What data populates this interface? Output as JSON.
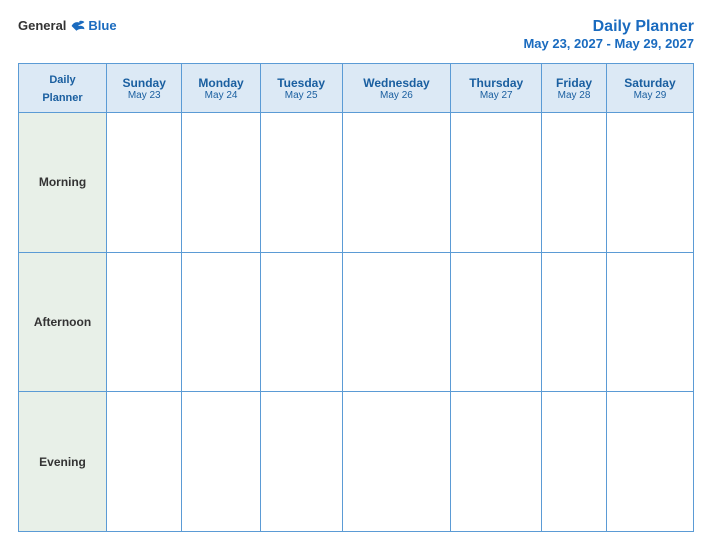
{
  "header": {
    "logo": {
      "general": "General",
      "blue": "Blue",
      "bird_symbol": "▶"
    },
    "title": "Daily Planner",
    "date_range": "May 23, 2027 - May 29, 2027"
  },
  "table": {
    "label_header": "Daily\nPlanner",
    "columns": [
      {
        "day": "Sunday",
        "date": "May 23"
      },
      {
        "day": "Monday",
        "date": "May 24"
      },
      {
        "day": "Tuesday",
        "date": "May 25"
      },
      {
        "day": "Wednesday",
        "date": "May 26"
      },
      {
        "day": "Thursday",
        "date": "May 27"
      },
      {
        "day": "Friday",
        "date": "May 28"
      },
      {
        "day": "Saturday",
        "date": "May 29"
      }
    ],
    "rows": [
      {
        "label": "Morning"
      },
      {
        "label": "Afternoon"
      },
      {
        "label": "Evening"
      }
    ]
  }
}
